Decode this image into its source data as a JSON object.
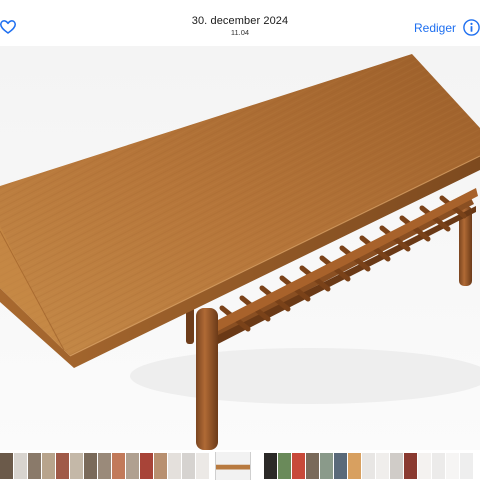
{
  "header": {
    "date": "30. december 2024",
    "time": "11.04",
    "edit_label": "Rediger",
    "favorite_icon": "heart-outline-icon",
    "info_icon": "info-circle-icon"
  },
  "colors": {
    "accent": "#1e6ff0",
    "background": "#ffffff"
  },
  "photo": {
    "subject": "teak coffee table with slatted lower shelf"
  },
  "filmstrip": {
    "thumbnail_count": 35,
    "selected_index": 13
  }
}
